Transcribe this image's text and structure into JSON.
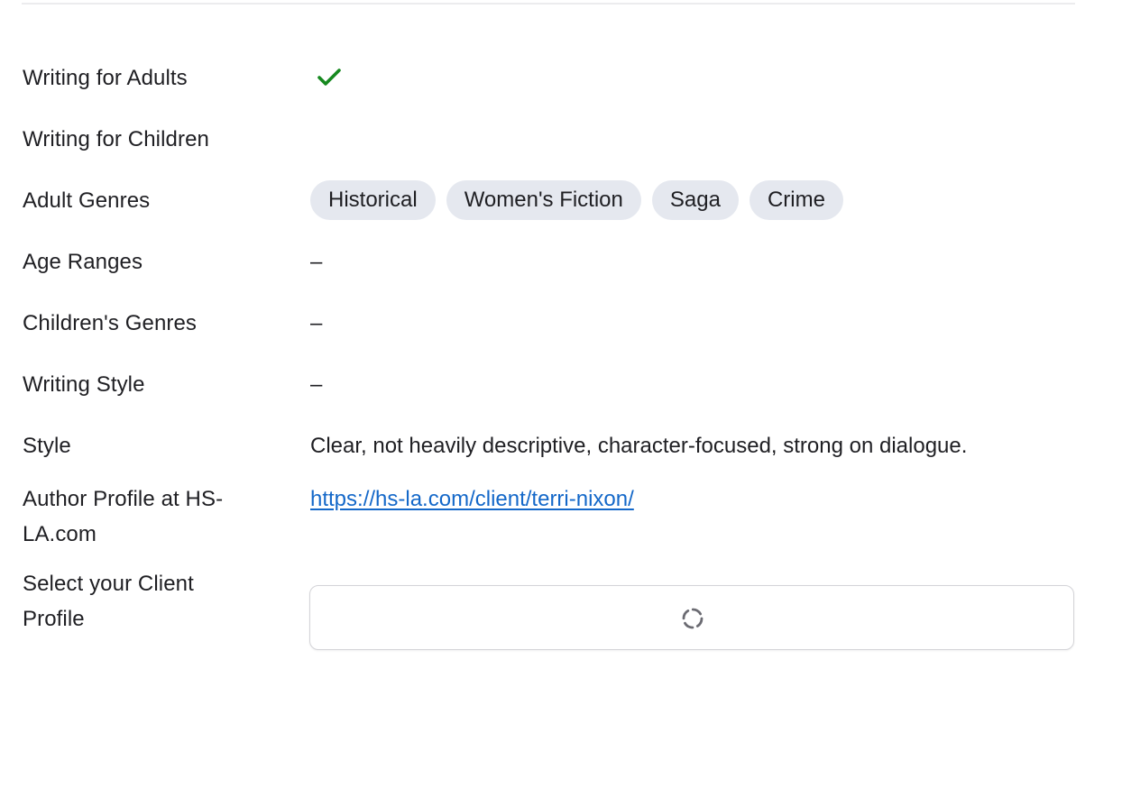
{
  "details": {
    "writing_for_adults": {
      "label": "Writing for Adults",
      "checked": true
    },
    "writing_for_children": {
      "label": "Writing for Children",
      "checked": false
    },
    "adult_genres": {
      "label": "Adult Genres",
      "tags": [
        "Historical",
        "Women's Fiction",
        "Saga",
        "Crime"
      ]
    },
    "age_ranges": {
      "label": "Age Ranges",
      "value": "–"
    },
    "childrens_genres": {
      "label": "Children's Genres",
      "value": "–"
    },
    "writing_style": {
      "label": "Writing Style",
      "value": "–"
    },
    "style": {
      "label": "Style",
      "value": "Clear, not heavily descriptive, character-focused, strong on dialogue."
    },
    "author_profile": {
      "label": "Author Profile at HS-LA.com",
      "url": "https://hs-la.com/client/terri-nixon/"
    },
    "client_profile": {
      "label": "Select your Client Profile",
      "state": "loading"
    }
  },
  "icons": {
    "check": "check-icon",
    "spinner": "loading-spinner-icon"
  },
  "colors": {
    "check": "#16891f",
    "chip_bg": "#e5e8ef",
    "link": "#1468c9",
    "spinner": "#6b6b72"
  }
}
